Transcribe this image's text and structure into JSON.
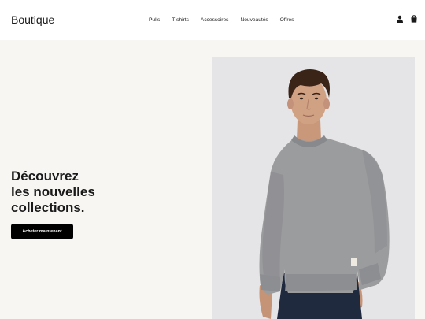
{
  "brand": {
    "name": "Boutique"
  },
  "nav": {
    "items": [
      {
        "label": "Pulls"
      },
      {
        "label": "T-shirts"
      },
      {
        "label": "Accessoires"
      },
      {
        "label": "Nouveautés"
      },
      {
        "label": "Offres"
      }
    ]
  },
  "header_icons": [
    "user-icon",
    "shopping-bag-icon"
  ],
  "hero": {
    "title_lines": [
      "Découvrez",
      "les nouvelles",
      "collections."
    ],
    "cta_label": "Acheter maintenant"
  },
  "colors": {
    "page_background": "#f7f6f3",
    "header_background": "#ffffff",
    "photo_background": "#e5e4e6",
    "button_background": "#000000",
    "button_text": "#ffffff",
    "sweater": "#9b9c9e",
    "trousers": "#1f2a3f"
  }
}
